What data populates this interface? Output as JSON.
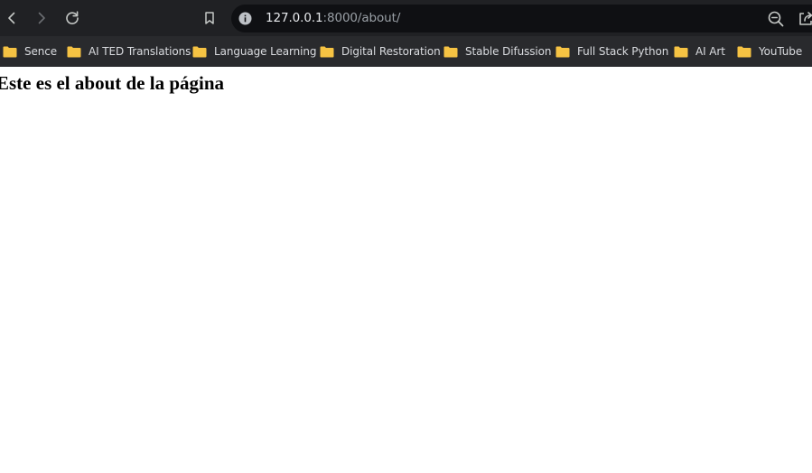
{
  "browser": {
    "colors": {
      "toolbar": "#202124",
      "omnibox": "#0f1013",
      "bookmark_bar": "#292a2d",
      "folder": "#f6c343",
      "text": "#dadce0"
    },
    "url": {
      "host": "127.0.0.1",
      "rest": ":8000/about/"
    },
    "icons": {
      "back": "chevron-left-icon",
      "forward": "chevron-right-icon",
      "reload": "reload-icon",
      "bookmark": "bookmark-icon",
      "site_info": "info-icon",
      "zoom": "zoom-out-icon",
      "share": "share-icon"
    },
    "bookmarks": [
      {
        "label": "Sence"
      },
      {
        "label": "AI TED Translations"
      },
      {
        "label": "Language Learning"
      },
      {
        "label": "Digital Restoration"
      },
      {
        "label": "Stable Difussion"
      },
      {
        "label": "Full Stack Python"
      },
      {
        "label": "AI Art"
      },
      {
        "label": "YouTube"
      }
    ]
  },
  "page": {
    "heading": "Este es el about de la página"
  }
}
